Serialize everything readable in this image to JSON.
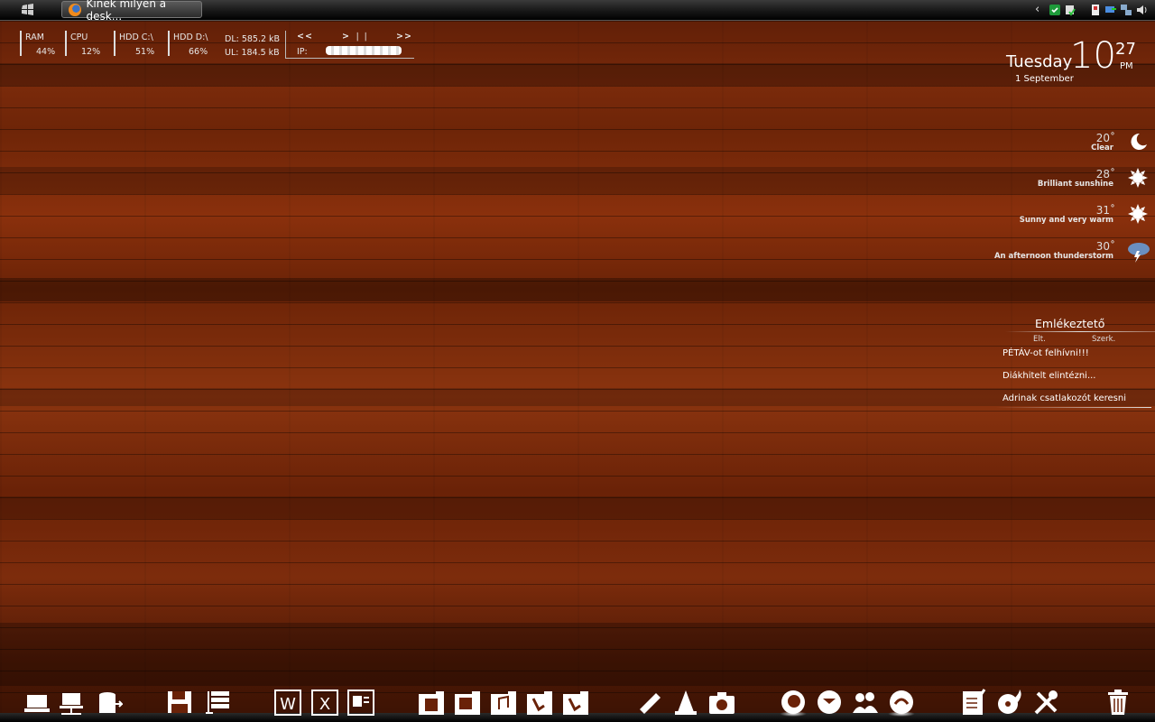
{
  "taskbar": {
    "task_title": "Kinek milyen a desk..."
  },
  "sysmon": {
    "ram": {
      "label": "RAM",
      "value": "44%"
    },
    "cpu": {
      "label": "CPU",
      "value": "12%"
    },
    "hddc": {
      "label": "HDD C:\\",
      "value": "51%"
    },
    "hddd": {
      "label": "HDD D:\\",
      "value": "66%"
    },
    "dl": "DL: 585.2 kB",
    "ul": "UL: 184.5 kB",
    "media_prev": "<<",
    "media_play": "> ❘❘",
    "media_next": ">>",
    "ip_label": "IP:"
  },
  "clock": {
    "day": "Tuesday",
    "hour": "10",
    "minute": "27",
    "ampm": "PM",
    "date": "1 September"
  },
  "weather": [
    {
      "temp": "20˚",
      "desc": "Clear",
      "icon": "moon-icon"
    },
    {
      "temp": "28˚",
      "desc": "Brilliant sunshine",
      "icon": "sun-icon"
    },
    {
      "temp": "31˚",
      "desc": "Sunny and very warm",
      "icon": "sun-icon"
    },
    {
      "temp": "30˚",
      "desc": "An afternoon thunderstorm",
      "icon": "thunderstorm-icon"
    }
  ],
  "reminder": {
    "title": "Emlékeztető",
    "action_left": "Elt.",
    "action_right": "Szerk.",
    "items": [
      "PÉTÁV-ot felhívni!!!",
      "Diákhitelt elintézni...",
      "Adrinak csatlakozót keresni"
    ]
  },
  "dock": {
    "icons": [
      "computer-icon",
      "network-icon",
      "drive-icon",
      "floppy-icon",
      "archive-icon",
      "word-icon",
      "excel-icon",
      "powerpoint-icon",
      "video-folder-icon",
      "pictures-folder-icon",
      "music-folder-icon",
      "downloads-folder-icon",
      "documents-folder-icon",
      "ruler-tools-icon",
      "vlc-icon",
      "camera-icon",
      "firefox-icon",
      "thunderbird-icon",
      "messenger-icon",
      "bittorrent-icon",
      "notepad-icon",
      "burn-icon",
      "tools-icon",
      "trash-icon"
    ]
  },
  "colors": {
    "wood_base": "#7a2a0b",
    "wood_dark": "#3a1204",
    "taskbar": "#1a1a1a"
  }
}
